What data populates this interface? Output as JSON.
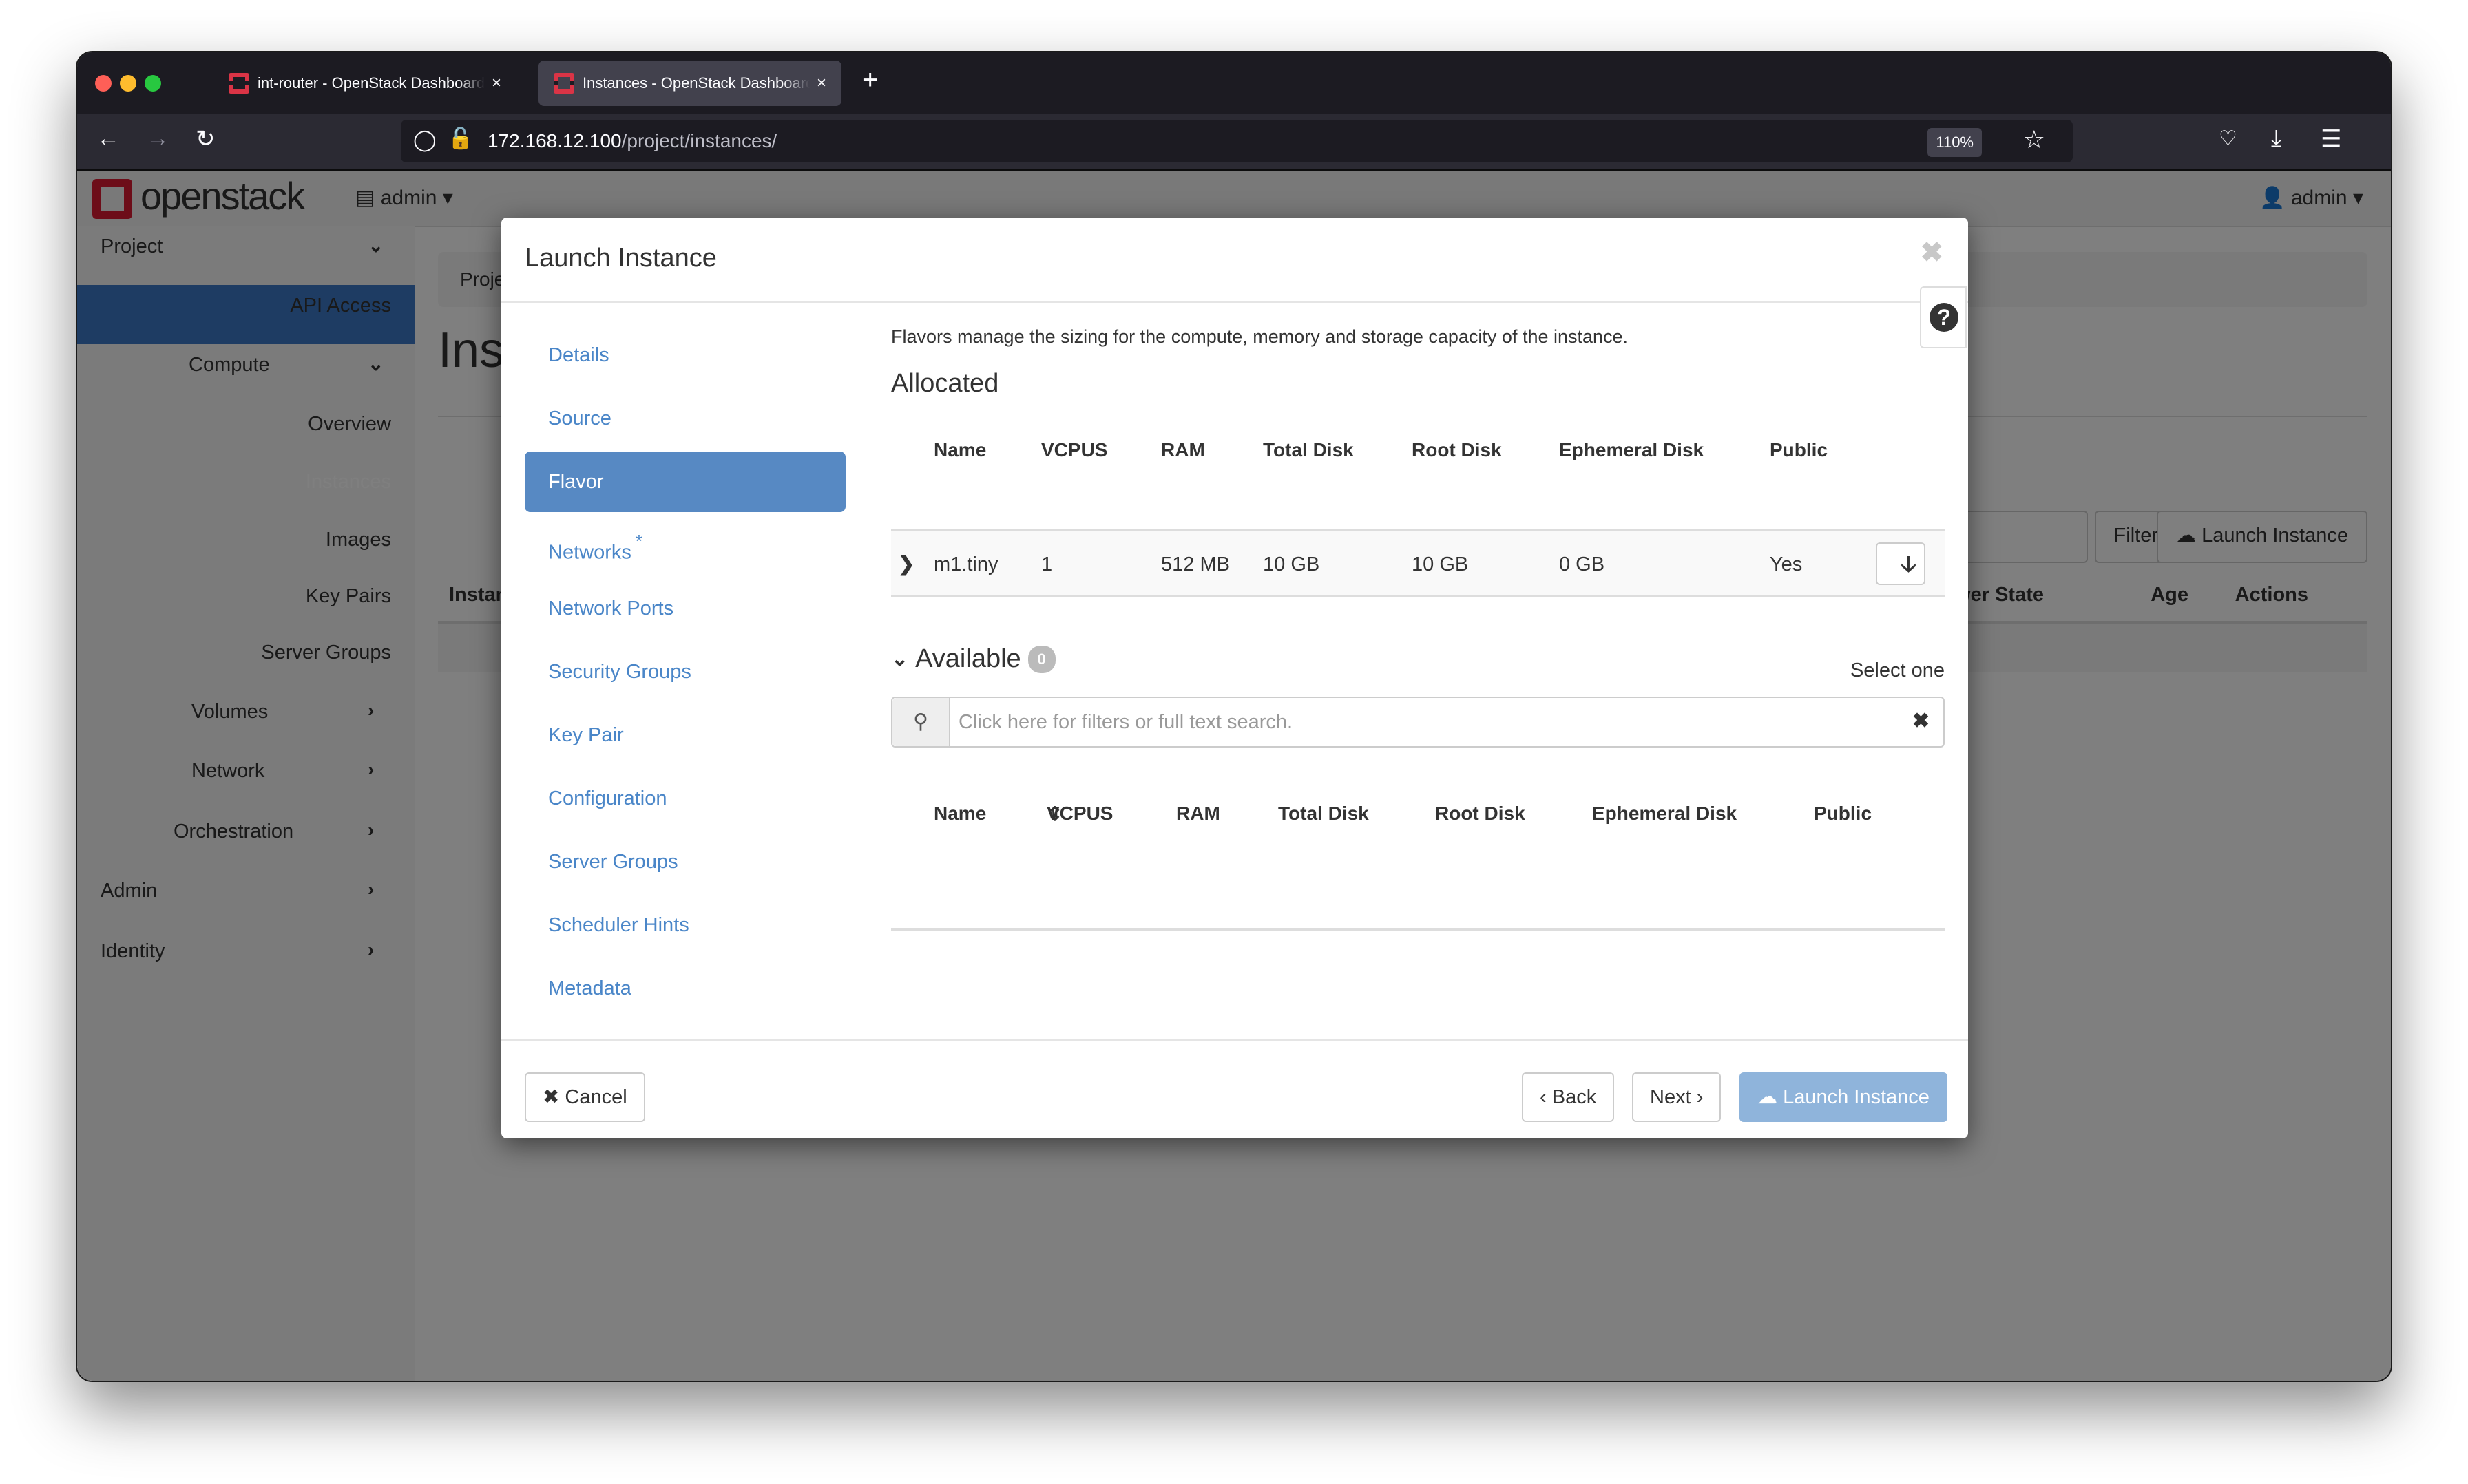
{
  "browser": {
    "tabs": [
      {
        "title": "int-router - OpenStack Dashboard",
        "active": false
      },
      {
        "title": "Instances - OpenStack Dashboard",
        "active": true
      }
    ],
    "new_tab_label": "+",
    "close_tab_glyph": "×",
    "url_host": "172.168.12.100",
    "url_path": "/project/instances/",
    "zoom_level": "110%",
    "icons": [
      "back-icon",
      "forward-icon",
      "reload-icon",
      "shield-icon",
      "lock-icon",
      "star-icon",
      "pocket-icon",
      "download-icon",
      "menu-icon"
    ]
  },
  "header": {
    "logo_text": "openstack",
    "project_dropdown": "admin",
    "user_dropdown": "admin"
  },
  "sidebar": {
    "items": [
      {
        "label": "Project",
        "type": "section",
        "expanded": true
      },
      {
        "label": "API Access",
        "type": "link"
      },
      {
        "label": "Compute",
        "type": "subsection",
        "expanded": true
      },
      {
        "label": "Overview",
        "type": "link"
      },
      {
        "label": "Instances",
        "type": "link",
        "active": true
      },
      {
        "label": "Images",
        "type": "link"
      },
      {
        "label": "Key Pairs",
        "type": "link"
      },
      {
        "label": "Server Groups",
        "type": "link"
      },
      {
        "label": "Volumes",
        "type": "subsection",
        "expanded": false
      },
      {
        "label": "Network",
        "type": "subsection",
        "expanded": false
      },
      {
        "label": "Orchestration",
        "type": "subsection",
        "expanded": false
      },
      {
        "label": "Admin",
        "type": "section",
        "expanded": false
      },
      {
        "label": "Identity",
        "type": "section",
        "expanded": false
      }
    ]
  },
  "background_page": {
    "breadcrumb": "Project",
    "heading": "Instances",
    "filter_button": "Filter",
    "launch_button": "Launch Instance",
    "columns": [
      "Instance Name",
      "Power State",
      "Age",
      "Actions"
    ]
  },
  "modal": {
    "title": "Launch Instance",
    "close_glyph": "✖",
    "help_glyph": "?",
    "wizard_steps": [
      {
        "label": "Details",
        "active": false,
        "required": false
      },
      {
        "label": "Source",
        "active": false,
        "required": false
      },
      {
        "label": "Flavor",
        "active": true,
        "required": false
      },
      {
        "label": "Networks",
        "active": false,
        "required": true
      },
      {
        "label": "Network Ports",
        "active": false,
        "required": false
      },
      {
        "label": "Security Groups",
        "active": false,
        "required": false
      },
      {
        "label": "Key Pair",
        "active": false,
        "required": false
      },
      {
        "label": "Configuration",
        "active": false,
        "required": false
      },
      {
        "label": "Server Groups",
        "active": false,
        "required": false
      },
      {
        "label": "Scheduler Hints",
        "active": false,
        "required": false
      },
      {
        "label": "Metadata",
        "active": false,
        "required": false
      }
    ],
    "required_marker": "*",
    "description": "Flavors manage the sizing for the compute, memory and storage capacity of the instance.",
    "allocated": {
      "heading": "Allocated",
      "columns": [
        "Name",
        "VCPUS",
        "RAM",
        "Total Disk",
        "Root Disk",
        "Ephemeral Disk",
        "Public"
      ],
      "rows": [
        {
          "name": "m1.tiny",
          "vcpus": "1",
          "ram": "512 MB",
          "total_disk": "10 GB",
          "root_disk": "10 GB",
          "ephemeral_disk": "0 GB",
          "public": "Yes"
        }
      ]
    },
    "available": {
      "heading": "Available",
      "count": "0",
      "select_hint": "Select one",
      "search_placeholder": "Click here for filters or full text search.",
      "search_value": "",
      "columns": [
        "Name",
        "VCPUS",
        "RAM",
        "Total Disk",
        "Root Disk",
        "Ephemeral Disk",
        "Public"
      ],
      "sorted_column": "VCPUS",
      "rows": []
    },
    "footer": {
      "cancel": "Cancel",
      "back": "Back",
      "next": "Next",
      "launch": "Launch Instance"
    }
  },
  "colors": {
    "accent": "#5789c3",
    "link": "#4a86c8",
    "launch_disabled": "#8fb4db",
    "brand_red": "#da1a32",
    "sidebar_active": "#3d79c7"
  }
}
